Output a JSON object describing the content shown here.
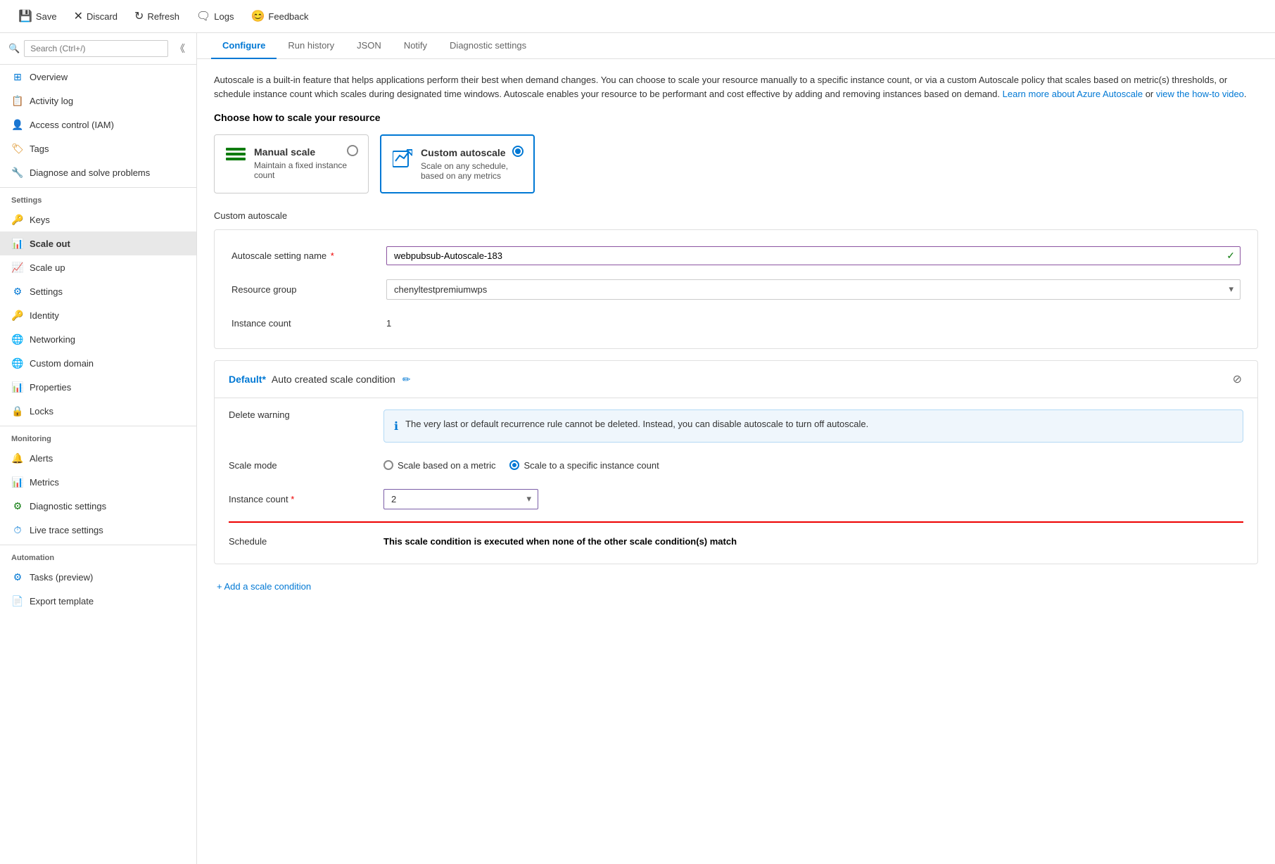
{
  "toolbar": {
    "save_label": "Save",
    "discard_label": "Discard",
    "refresh_label": "Refresh",
    "logs_label": "Logs",
    "feedback_label": "Feedback"
  },
  "sidebar": {
    "search_placeholder": "Search (Ctrl+/)",
    "items": [
      {
        "id": "overview",
        "label": "Overview",
        "icon": "⊞",
        "color": "icon-blue"
      },
      {
        "id": "activity-log",
        "label": "Activity log",
        "icon": "📋",
        "color": "icon-blue"
      },
      {
        "id": "access-control",
        "label": "Access control (IAM)",
        "icon": "👤",
        "color": "icon-blue"
      },
      {
        "id": "tags",
        "label": "Tags",
        "icon": "🏷",
        "color": "icon-orange"
      },
      {
        "id": "diagnose",
        "label": "Diagnose and solve problems",
        "icon": "🔧",
        "color": "icon-blue"
      }
    ],
    "settings_section": "Settings",
    "settings_items": [
      {
        "id": "keys",
        "label": "Keys",
        "icon": "🔑",
        "color": "icon-orange"
      },
      {
        "id": "scale-out",
        "label": "Scale out",
        "icon": "📊",
        "color": "icon-blue",
        "active": true
      },
      {
        "id": "scale-up",
        "label": "Scale up",
        "icon": "📈",
        "color": "icon-blue"
      },
      {
        "id": "settings",
        "label": "Settings",
        "icon": "⚙",
        "color": "icon-blue"
      },
      {
        "id": "identity",
        "label": "Identity",
        "icon": "🔑",
        "color": "icon-orange"
      },
      {
        "id": "networking",
        "label": "Networking",
        "icon": "🌐",
        "color": "icon-blue"
      },
      {
        "id": "custom-domain",
        "label": "Custom domain",
        "icon": "🌐",
        "color": "icon-blue"
      },
      {
        "id": "properties",
        "label": "Properties",
        "icon": "📊",
        "color": "icon-blue"
      },
      {
        "id": "locks",
        "label": "Locks",
        "icon": "🔒",
        "color": "icon-blue"
      }
    ],
    "monitoring_section": "Monitoring",
    "monitoring_items": [
      {
        "id": "alerts",
        "label": "Alerts",
        "icon": "🔔",
        "color": "icon-green"
      },
      {
        "id": "metrics",
        "label": "Metrics",
        "icon": "📊",
        "color": "icon-blue"
      },
      {
        "id": "diagnostic-settings",
        "label": "Diagnostic settings",
        "icon": "⚙",
        "color": "icon-green"
      },
      {
        "id": "live-trace",
        "label": "Live trace settings",
        "icon": "⏱",
        "color": "icon-blue"
      }
    ],
    "automation_section": "Automation",
    "automation_items": [
      {
        "id": "tasks",
        "label": "Tasks (preview)",
        "icon": "⚙",
        "color": "icon-blue"
      },
      {
        "id": "export-template",
        "label": "Export template",
        "icon": "📄",
        "color": "icon-blue"
      }
    ]
  },
  "tabs": [
    {
      "id": "configure",
      "label": "Configure",
      "active": true
    },
    {
      "id": "run-history",
      "label": "Run history"
    },
    {
      "id": "json",
      "label": "JSON"
    },
    {
      "id": "notify",
      "label": "Notify"
    },
    {
      "id": "diagnostic-settings",
      "label": "Diagnostic settings"
    }
  ],
  "description": {
    "text": "Autoscale is a built-in feature that helps applications perform their best when demand changes. You can choose to scale your resource manually to a specific instance count, or via a custom Autoscale policy that scales based on metric(s) thresholds, or schedule instance count which scales during designated time windows. Autoscale enables your resource to be performant and cost effective by adding and removing instances based on demand.",
    "link1_text": "Learn more about Azure Autoscale",
    "link2_text": "view the how-to video"
  },
  "scale_section": {
    "title": "Choose how to scale your resource",
    "manual_card": {
      "title": "Manual scale",
      "description": "Maintain a fixed instance count",
      "selected": false
    },
    "custom_card": {
      "title": "Custom autoscale",
      "description": "Scale on any schedule, based on any metrics",
      "selected": true
    }
  },
  "custom_autoscale_label": "Custom autoscale",
  "autoscale_form": {
    "name_label": "Autoscale setting name",
    "name_value": "webpubsub-Autoscale-183",
    "resource_group_label": "Resource group",
    "resource_group_value": "chenyltestpremiumwps",
    "resource_group_options": [
      "chenyltestpremiumwps"
    ],
    "instance_count_label": "Instance count",
    "instance_count_value": "1"
  },
  "condition": {
    "default_label": "Default*",
    "auto_created_label": "Auto created scale condition",
    "delete_warning_label": "Delete warning",
    "delete_warning_text": "The very last or default recurrence rule cannot be deleted. Instead, you can disable autoscale to turn off autoscale.",
    "scale_mode_label": "Scale mode",
    "scale_metric_option": "Scale based on a metric",
    "scale_instance_option": "Scale to a specific instance count",
    "scale_metric_selected": false,
    "scale_instance_selected": true,
    "instance_count_label": "Instance count",
    "instance_count_required": true,
    "instance_count_value": "2",
    "schedule_label": "Schedule",
    "schedule_text": "This scale condition is executed when none of the other scale condition(s) match"
  },
  "add_condition_label": "+ Add a scale condition"
}
